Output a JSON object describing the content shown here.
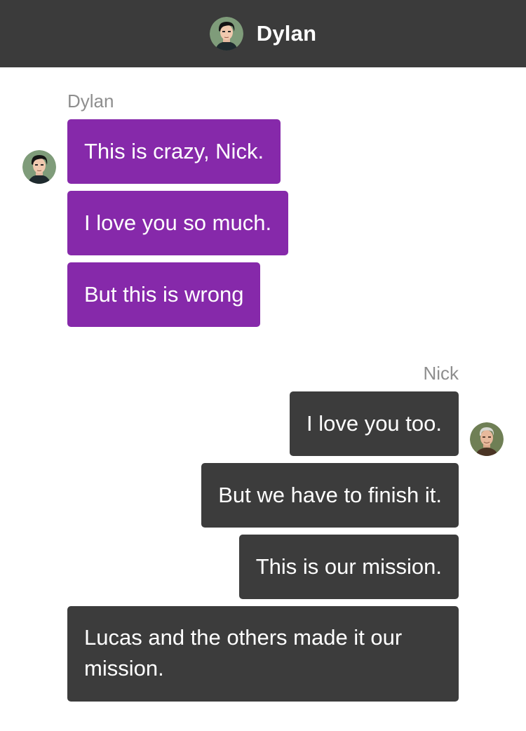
{
  "header": {
    "title": "Dylan",
    "avatar_icon": "dylan-avatar"
  },
  "conversation": {
    "groups": [
      {
        "sender": "Dylan",
        "side": "left",
        "bubble_color": "#8629aa",
        "messages": [
          "This is crazy, Nick.",
          "I love you so much.",
          "But this is wrong"
        ]
      },
      {
        "sender": "Nick",
        "side": "right",
        "bubble_color": "#3c3c3c",
        "messages": [
          "I love you too.",
          "But we have to finish it.",
          "This is our mission.",
          "Lucas and the others made it our mission."
        ]
      }
    ]
  },
  "colors": {
    "header_bg": "#3b3b3b",
    "sender_name": "#8e8e8e",
    "background": "#ffffff"
  }
}
